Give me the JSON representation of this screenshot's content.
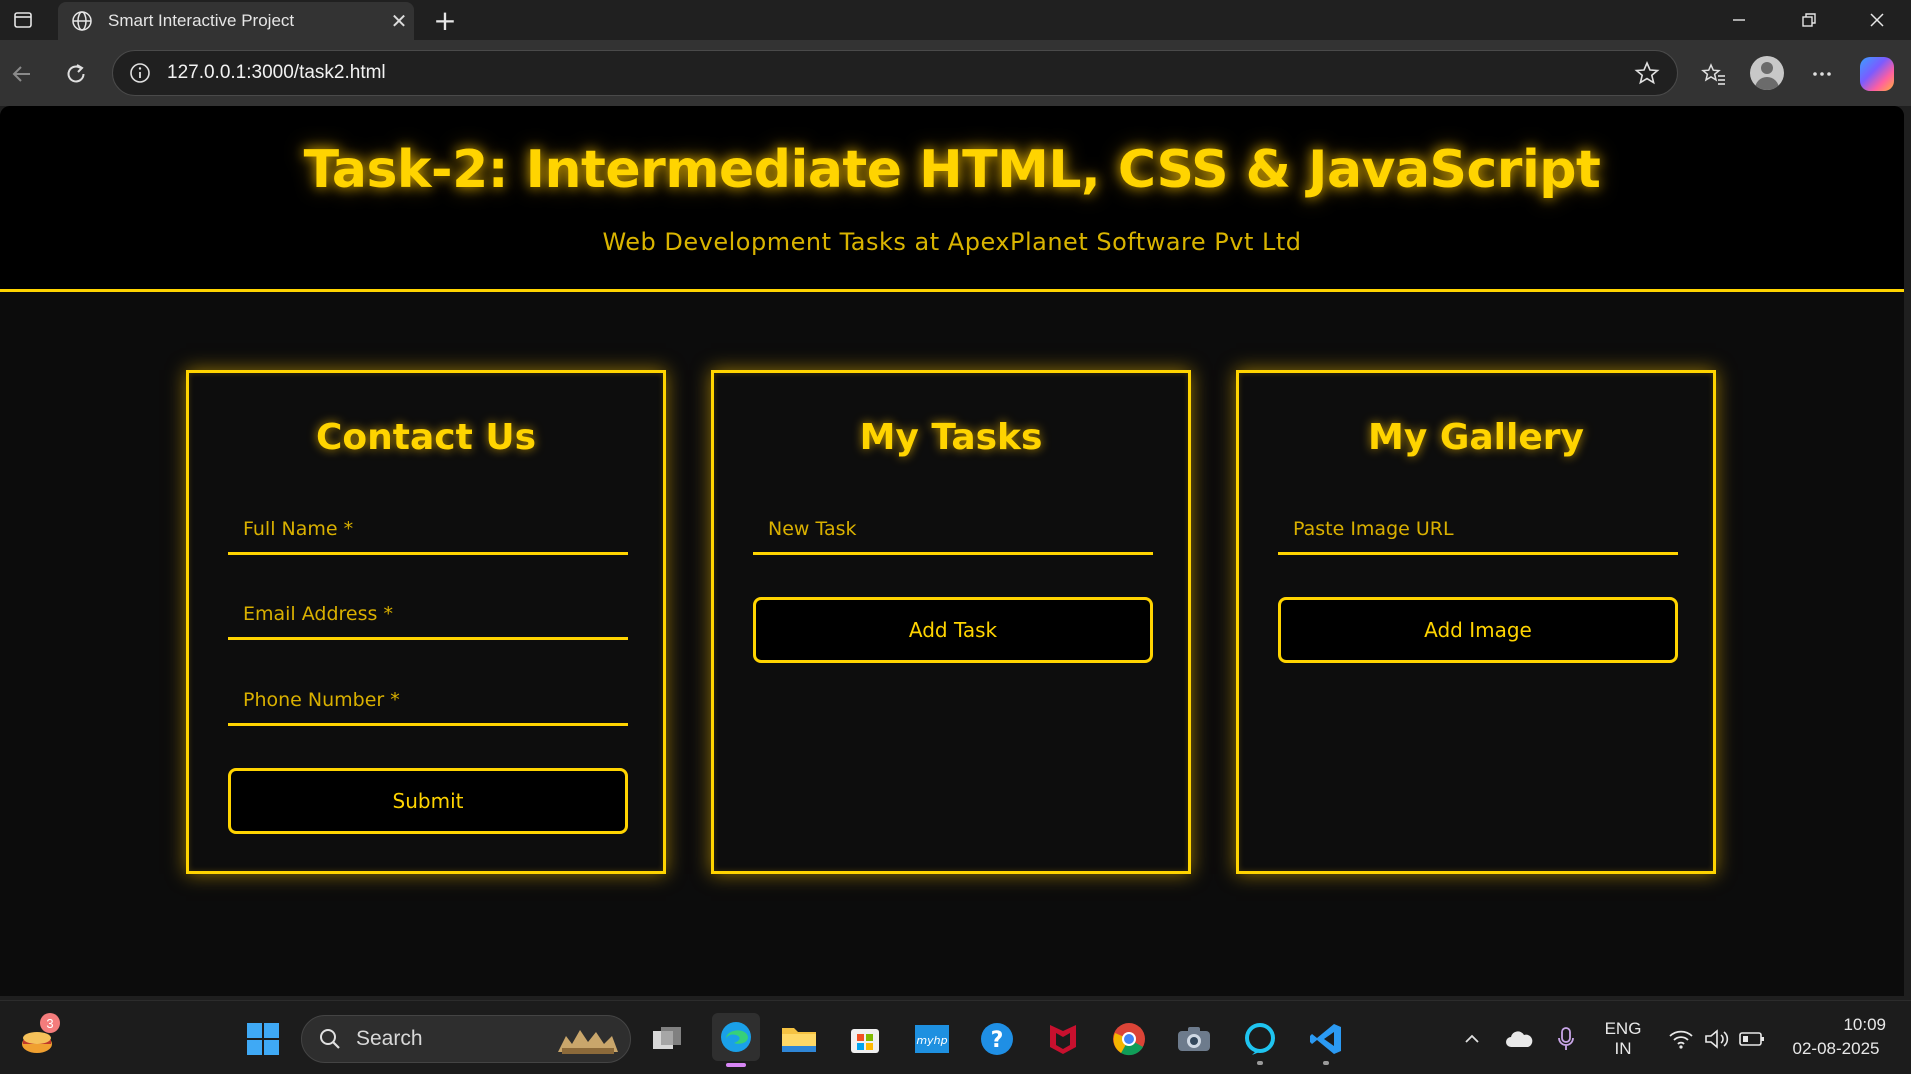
{
  "browser": {
    "tab_title": "Smart Interactive Project",
    "url": "127.0.0.1:3000/task2.html"
  },
  "page": {
    "title": "Task-2: Intermediate HTML, CSS & JavaScript",
    "subtitle": "Web Development Tasks at ApexPlanet Software Pvt Ltd",
    "accent_color": "#ffd400",
    "contact": {
      "heading": "Contact Us",
      "name_placeholder": "Full Name *",
      "email_placeholder": "Email Address *",
      "phone_placeholder": "Phone Number *",
      "submit_label": "Submit"
    },
    "tasks": {
      "heading": "My Tasks",
      "input_placeholder": "New Task",
      "button_label": "Add Task"
    },
    "gallery": {
      "heading": "My Gallery",
      "input_placeholder": "Paste Image URL",
      "button_label": "Add Image"
    }
  },
  "taskbar": {
    "search_label": "Search",
    "widget_badge": "3",
    "language_line1": "ENG",
    "language_line2": "IN",
    "time": "10:09",
    "date": "02-08-2025",
    "pinned_icons": [
      "task-view-icon",
      "edge-icon",
      "file-explorer-icon",
      "microsoft-store-icon",
      "myhp-icon",
      "help-icon",
      "mcafee-icon",
      "chrome-icon",
      "camera-icon",
      "alexa-icon",
      "vscode-icon"
    ]
  }
}
